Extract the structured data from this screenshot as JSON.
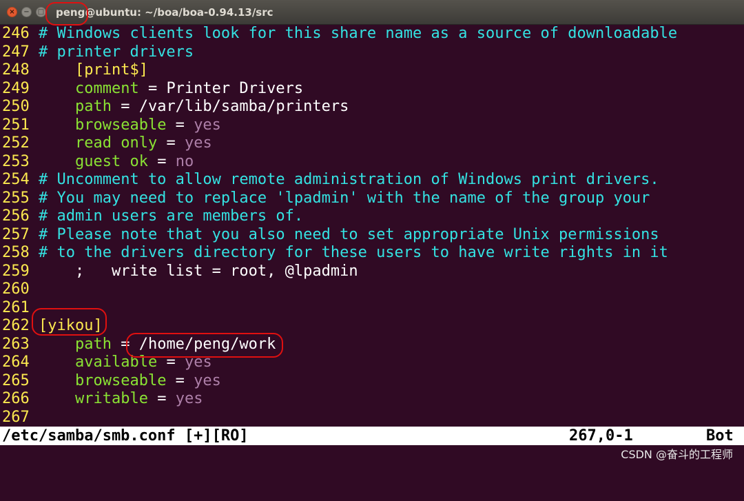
{
  "window": {
    "title": "peng@ubuntu: ~/boa/boa-0.94.13/src",
    "close_glyph": "×",
    "minimize_glyph": "−",
    "maximize_glyph": "□"
  },
  "lines": [
    {
      "n": "246",
      "parts": [
        {
          "t": "# Windows clients look for this share name as a source of downloadable",
          "c": "cm"
        }
      ]
    },
    {
      "n": "247",
      "parts": [
        {
          "t": "# printer drivers",
          "c": "cm"
        }
      ]
    },
    {
      "n": "248",
      "parts": [
        {
          "t": "    "
        },
        {
          "t": "[print$]",
          "c": "sec"
        }
      ]
    },
    {
      "n": "249",
      "parts": [
        {
          "t": "    "
        },
        {
          "t": "comment",
          "c": "key"
        },
        {
          "t": " = Printer Drivers",
          "c": "txt"
        }
      ]
    },
    {
      "n": "250",
      "parts": [
        {
          "t": "    "
        },
        {
          "t": "path",
          "c": "key"
        },
        {
          "t": " = /var/lib/samba/printers",
          "c": "txt"
        }
      ]
    },
    {
      "n": "251",
      "parts": [
        {
          "t": "    "
        },
        {
          "t": "browseable",
          "c": "key"
        },
        {
          "t": " = ",
          "c": "txt"
        },
        {
          "t": "yes",
          "c": "val"
        }
      ]
    },
    {
      "n": "252",
      "parts": [
        {
          "t": "    "
        },
        {
          "t": "read only",
          "c": "key"
        },
        {
          "t": " = ",
          "c": "txt"
        },
        {
          "t": "yes",
          "c": "val"
        }
      ]
    },
    {
      "n": "253",
      "parts": [
        {
          "t": "    "
        },
        {
          "t": "guest ok",
          "c": "key"
        },
        {
          "t": " = ",
          "c": "txt"
        },
        {
          "t": "no",
          "c": "val"
        }
      ]
    },
    {
      "n": "254",
      "parts": [
        {
          "t": "# Uncomment to allow remote administration of Windows print drivers.",
          "c": "cm"
        }
      ]
    },
    {
      "n": "255",
      "parts": [
        {
          "t": "# You may need to replace 'lpadmin' with the name of the group your",
          "c": "cm"
        }
      ]
    },
    {
      "n": "256",
      "parts": [
        {
          "t": "# admin users are members of.",
          "c": "cm"
        }
      ]
    },
    {
      "n": "257",
      "parts": [
        {
          "t": "# Please note that you also need to set appropriate Unix permissions",
          "c": "cm"
        }
      ]
    },
    {
      "n": "258",
      "parts": [
        {
          "t": "# to the drivers directory for these users to have write rights in it",
          "c": "cm"
        }
      ]
    },
    {
      "n": "259",
      "parts": [
        {
          "t": "    ;   write list = root, @lpadmin",
          "c": "txt"
        }
      ]
    },
    {
      "n": "260",
      "parts": []
    },
    {
      "n": "261",
      "parts": []
    },
    {
      "n": "262",
      "parts": [
        {
          "t": "[yikou]",
          "c": "sec"
        }
      ]
    },
    {
      "n": "263",
      "parts": [
        {
          "t": "    "
        },
        {
          "t": "path",
          "c": "key"
        },
        {
          "t": " = /home/peng/work",
          "c": "txt"
        }
      ]
    },
    {
      "n": "264",
      "parts": [
        {
          "t": "    "
        },
        {
          "t": "available",
          "c": "key"
        },
        {
          "t": " = ",
          "c": "txt"
        },
        {
          "t": "yes",
          "c": "val"
        }
      ]
    },
    {
      "n": "265",
      "parts": [
        {
          "t": "    "
        },
        {
          "t": "browseable",
          "c": "key"
        },
        {
          "t": " = ",
          "c": "txt"
        },
        {
          "t": "yes",
          "c": "val"
        }
      ]
    },
    {
      "n": "266",
      "parts": [
        {
          "t": "    "
        },
        {
          "t": "writable",
          "c": "key"
        },
        {
          "t": " = ",
          "c": "txt"
        },
        {
          "t": "yes",
          "c": "val"
        }
      ]
    },
    {
      "n": "267",
      "parts": []
    }
  ],
  "status": {
    "file": "/etc/samba/smb.conf [+][RO]",
    "position": "267,0-1",
    "scroll": "Bot"
  },
  "watermark": "CSDN @奋斗的工程师",
  "colors": {
    "background": "#300a24",
    "line_number": "#fce94f",
    "comment": "#34e2e2",
    "section": "#fce94f",
    "key": "#8ae234",
    "value": "#ad7fa8",
    "annotation": "#e01010"
  }
}
